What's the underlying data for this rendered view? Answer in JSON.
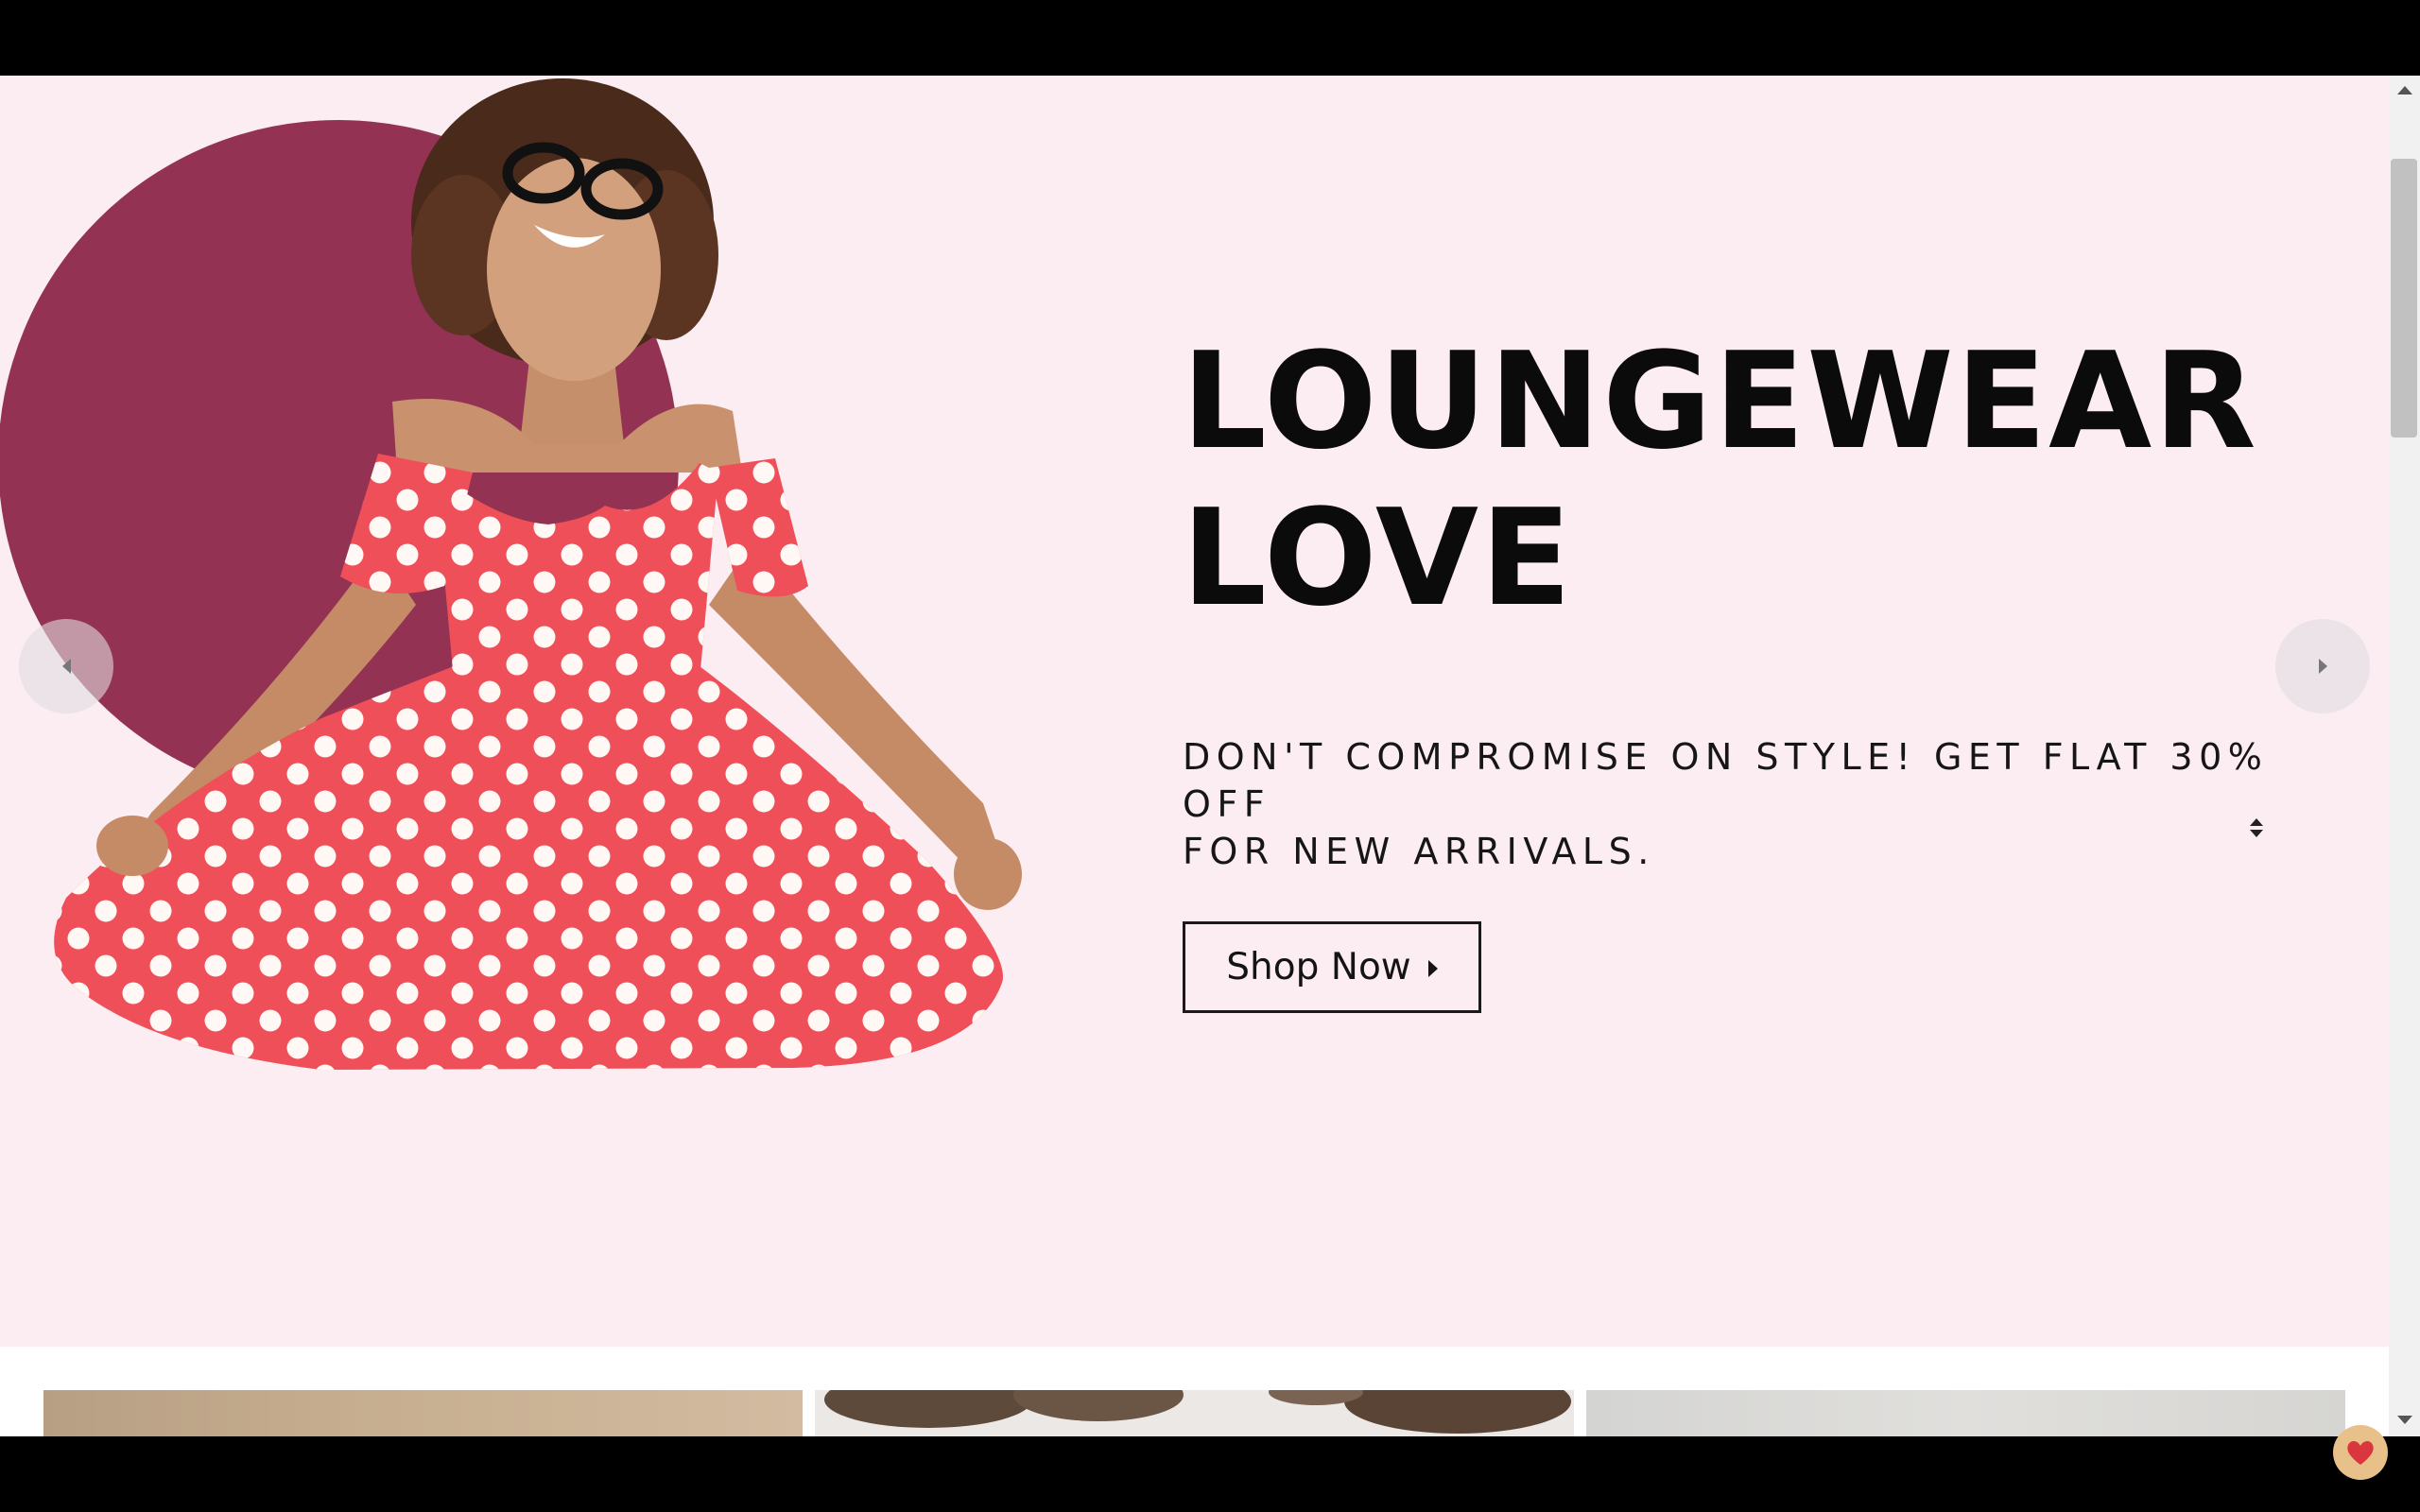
{
  "hero": {
    "headline_line1": "LOUNGEWEAR",
    "headline_line2": "LOVE",
    "subtext_line1": "DON'T COMPROMISE ON STYLE! GET FLAT 30% OFF",
    "subtext_line2": "FOR NEW ARRIVALS.",
    "cta_label": "Shop Now",
    "background_color": "#fbedf2",
    "accent_circle_color": "#933253",
    "dress_color": "#ef4f58"
  },
  "icons": {
    "prev": "chevron-left-icon",
    "next": "chevron-right-icon",
    "cta": "caret-right-icon",
    "scroll_hint": "sort-arrows-icon",
    "chat": "chat-heart-icon"
  }
}
